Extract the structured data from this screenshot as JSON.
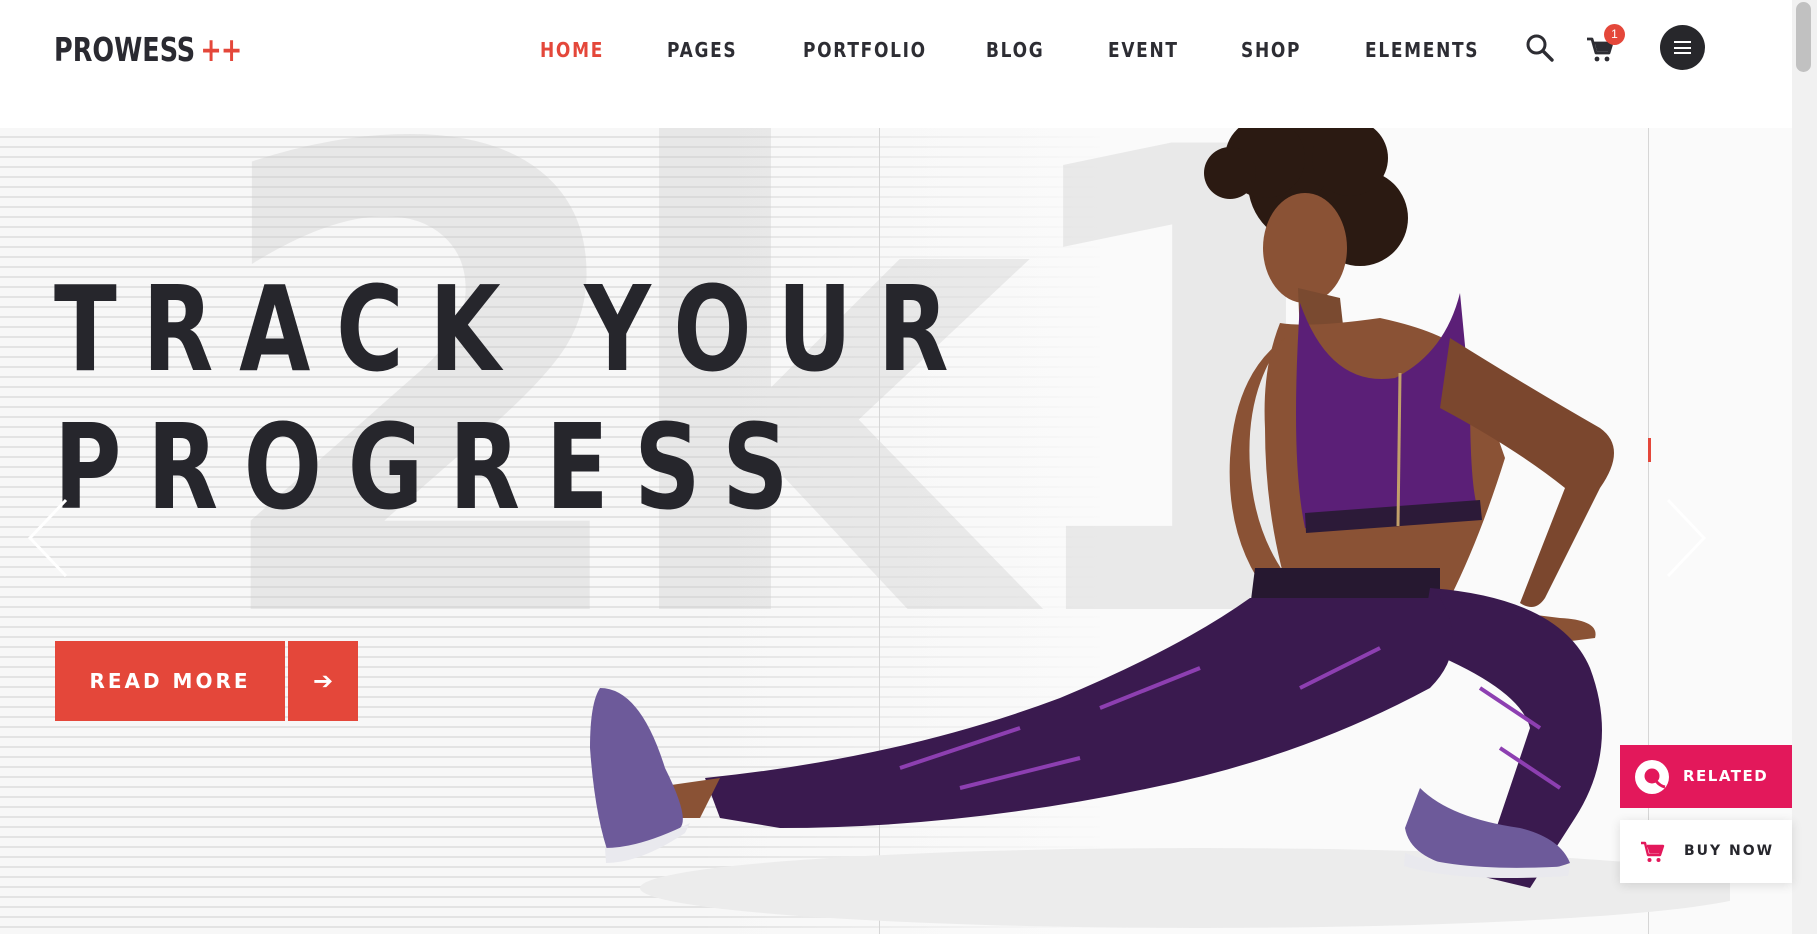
{
  "brand": {
    "name": "PROWESS",
    "mark": "++"
  },
  "nav": {
    "items": [
      {
        "label": "HOME",
        "active": true
      },
      {
        "label": "PAGES"
      },
      {
        "label": "PORTFOLIO"
      },
      {
        "label": "BLOG"
      },
      {
        "label": "EVENT"
      },
      {
        "label": "SHOP"
      },
      {
        "label": "ELEMENTS"
      }
    ],
    "cart_count": "1",
    "search_icon": "search-icon",
    "cart_icon": "cart-icon",
    "menu_icon": "hamburger-icon"
  },
  "hero": {
    "headline_line1": "TRACK YOUR",
    "headline_line2": "PROGRESS",
    "cta_label": "READ MORE",
    "cta_icon": "arrow-right-icon",
    "background_number": "2k1"
  },
  "side_buttons": {
    "related_label": "RELATED",
    "buy_now_label": "BUY NOW"
  },
  "colors": {
    "accent": "#e4473a",
    "dark": "#26262c",
    "related": "#e3185b",
    "outfit": "#3a1a4f"
  }
}
